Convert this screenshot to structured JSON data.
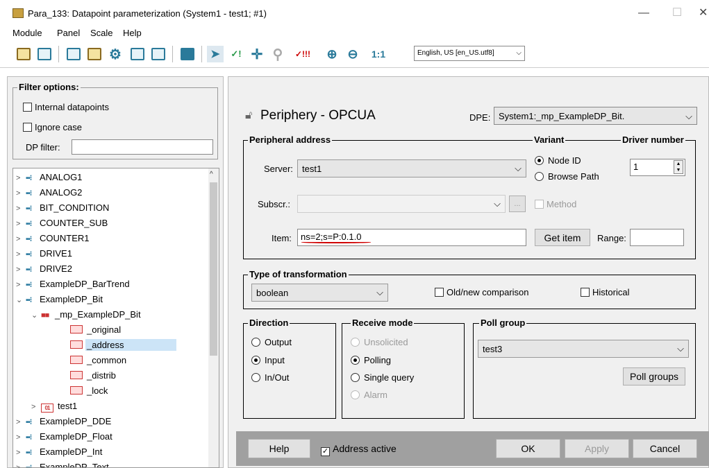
{
  "window": {
    "title": "Para_133: Datapoint parameterization (System1 - test1; #1)",
    "minimize": "—",
    "maximize": "☐",
    "close": "✕"
  },
  "menu": [
    "Module",
    "Panel",
    "Scale",
    "Help"
  ],
  "toolbar": {
    "lang": "English, US [en_US.utf8]",
    "zoom_label": "1:1",
    "check_label": "✓!",
    "check2_label": "✓!!!"
  },
  "filter": {
    "legend": "Filter options:",
    "internal": "Internal datapoints",
    "ignore_case": "Ignore case",
    "dp_filter_label": "DP filter:",
    "dp_filter_value": ""
  },
  "tree": [
    {
      "label": "ANALOG1",
      "level": 0,
      "arrow": ">",
      "icon": "dp"
    },
    {
      "label": "ANALOG2",
      "level": 0,
      "arrow": ">",
      "icon": "dp"
    },
    {
      "label": "BIT_CONDITION",
      "level": 0,
      "arrow": ">",
      "icon": "dp"
    },
    {
      "label": "COUNTER_SUB",
      "level": 0,
      "arrow": ">",
      "icon": "dp"
    },
    {
      "label": "COUNTER1",
      "level": 0,
      "arrow": ">",
      "icon": "dp"
    },
    {
      "label": "DRIVE1",
      "level": 0,
      "arrow": ">",
      "icon": "dp"
    },
    {
      "label": "DRIVE2",
      "level": 0,
      "arrow": ">",
      "icon": "dp"
    },
    {
      "label": "ExampleDP_BarTrend",
      "level": 0,
      "arrow": ">",
      "icon": "dp"
    },
    {
      "label": "ExampleDP_Bit",
      "level": 0,
      "arrow": "v",
      "icon": "dp"
    },
    {
      "label": "_mp_ExampleDP_Bit",
      "level": 1,
      "arrow": "v",
      "icon": "mp"
    },
    {
      "label": "_original",
      "level": 2,
      "arrow": "",
      "icon": "leaf"
    },
    {
      "label": "_address",
      "level": 2,
      "arrow": "",
      "icon": "leaf",
      "selected": true
    },
    {
      "label": "_common",
      "level": 2,
      "arrow": "",
      "icon": "leaf"
    },
    {
      "label": "_distrib",
      "level": 2,
      "arrow": "",
      "icon": "leaf"
    },
    {
      "label": "_lock",
      "level": 2,
      "arrow": "",
      "icon": "leaf"
    },
    {
      "label": "test1",
      "level": 1,
      "arrow": ">",
      "icon": "01"
    },
    {
      "label": "ExampleDP_DDE",
      "level": 0,
      "arrow": ">",
      "icon": "dp"
    },
    {
      "label": "ExampleDP_Float",
      "level": 0,
      "arrow": ">",
      "icon": "dp"
    },
    {
      "label": "ExampleDP_Int",
      "level": 0,
      "arrow": ">",
      "icon": "dp"
    },
    {
      "label": "ExampleDP_Text",
      "level": 0,
      "arrow": ">",
      "icon": "dp"
    }
  ],
  "periph": {
    "title": "Periphery - OPCUA",
    "dpe_label": "DPE:",
    "dpe_value": "System1:_mp_ExampleDP_Bit."
  },
  "address": {
    "legend": "Peripheral address",
    "server_label": "Server:",
    "server_value": "test1",
    "subscr_label": "Subscr.:",
    "subscr_btn": "...",
    "item_label": "Item:",
    "item_value": "ns=2;s=P:0.1.0",
    "get_item": "Get item",
    "range_label": "Range:"
  },
  "variant": {
    "legend": "Variant",
    "node_id": "Node ID",
    "browse_path": "Browse Path",
    "method": "Method"
  },
  "driver": {
    "legend": "Driver number",
    "value": "1"
  },
  "transform": {
    "legend": "Type of transformation",
    "value": "boolean",
    "old_new": "Old/new comparison",
    "historical": "Historical"
  },
  "direction": {
    "legend": "Direction",
    "output": "Output",
    "input": "Input",
    "inout": "In/Out"
  },
  "receive": {
    "legend": "Receive mode",
    "unsolicited": "Unsolicited",
    "polling": "Polling",
    "single": "Single query",
    "alarm": "Alarm"
  },
  "poll": {
    "legend": "Poll group",
    "value": "test3",
    "button": "Poll groups"
  },
  "bottom": {
    "help": "Help",
    "address_active": "Address active",
    "ok": "OK",
    "apply": "Apply",
    "cancel": "Cancel"
  },
  "colors": {
    "underline": "#d00000",
    "selection": "#cce4f7",
    "accent": "#2a7a9a"
  }
}
